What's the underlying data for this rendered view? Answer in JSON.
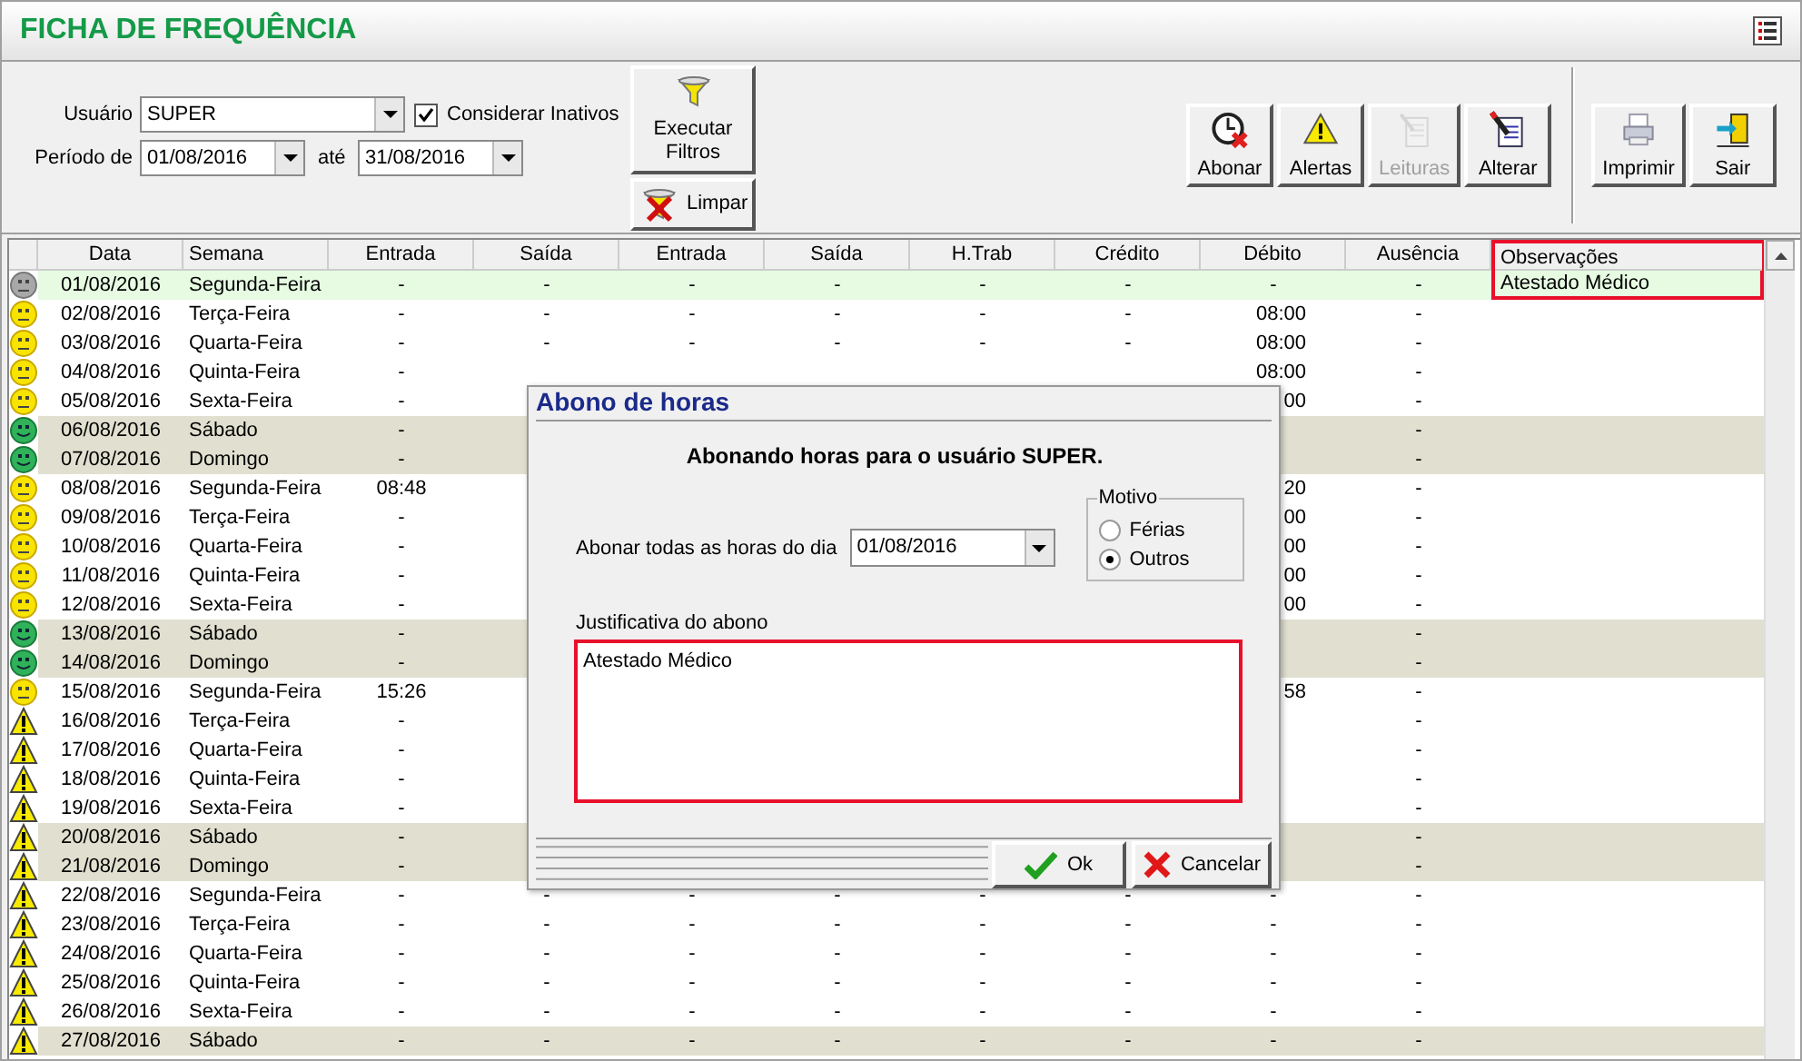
{
  "title": "FICHA DE FREQUÊNCIA",
  "filters": {
    "user_label": "Usuário",
    "user": "SUPER",
    "inactive": {
      "label": "Considerar Inativos",
      "checked": true
    },
    "period_label": "Período de",
    "date_from": "01/08/2016",
    "until_label": "até",
    "date_to": "31/08/2016"
  },
  "filter_buttons": [
    {
      "label": "Executar Filtros",
      "kind": "run"
    },
    {
      "label": "Limpar",
      "kind": "clear"
    }
  ],
  "toolbar": [
    {
      "label": "Abonar",
      "disabled": false
    },
    {
      "label": "Alertas",
      "disabled": false
    },
    {
      "label": "Leituras",
      "disabled": true
    },
    {
      "label": "Alterar",
      "disabled": false
    },
    {
      "label": "Imprimir",
      "disabled": false
    },
    {
      "label": "Sair",
      "disabled": false
    }
  ],
  "table": {
    "columns": [
      "Data",
      "Semana",
      "Entrada",
      "Saída",
      "Entrada",
      "Saída",
      "H.Trab",
      "Crédito",
      "Débito",
      "Ausência",
      "Observações"
    ],
    "notes_highlighted": true,
    "rows": [
      {
        "kind": "neutral",
        "cells": [
          "01/08/2016",
          "Segunda-Feira",
          "-",
          "-",
          "-",
          "-",
          "-",
          "-",
          "-",
          "-",
          "Atestado Médico"
        ],
        "selected": true,
        "weekend": false
      },
      {
        "kind": "ok",
        "cells": [
          "02/08/2016",
          "Terça-Feira",
          "-",
          "-",
          "-",
          "-",
          "-",
          "-",
          "08:00",
          "-",
          null
        ],
        "selected": false,
        "weekend": false
      },
      {
        "kind": "ok",
        "cells": [
          "03/08/2016",
          "Quarta-Feira",
          "-",
          "-",
          "-",
          "-",
          "-",
          "-",
          "08:00",
          "-",
          null
        ],
        "selected": false,
        "weekend": false
      },
      {
        "kind": "ok",
        "cells": [
          "04/08/2016",
          "Quinta-Feira",
          "-",
          null,
          null,
          null,
          null,
          null,
          "08:00",
          "-",
          null
        ],
        "selected": false,
        "weekend": false
      },
      {
        "kind": "ok",
        "cells": [
          "05/08/2016",
          "Sexta-Feira",
          "-",
          null,
          null,
          null,
          null,
          null,
          "00",
          "-",
          null
        ],
        "selected": false,
        "weekend": false
      },
      {
        "kind": "weekend",
        "cells": [
          "06/08/2016",
          "Sábado",
          "-",
          null,
          null,
          null,
          null,
          null,
          null,
          "-",
          null
        ],
        "selected": false,
        "weekend": true
      },
      {
        "kind": "weekend",
        "cells": [
          "07/08/2016",
          "Domingo",
          "-",
          null,
          null,
          null,
          null,
          null,
          null,
          "-",
          null
        ],
        "selected": false,
        "weekend": true
      },
      {
        "kind": "ok",
        "cells": [
          "08/08/2016",
          "Segunda-Feira",
          "08:48",
          null,
          null,
          null,
          null,
          null,
          "20",
          "-",
          null
        ],
        "selected": false,
        "weekend": false
      },
      {
        "kind": "ok",
        "cells": [
          "09/08/2016",
          "Terça-Feira",
          "-",
          null,
          null,
          null,
          null,
          null,
          "00",
          "-",
          null
        ],
        "selected": false,
        "weekend": false
      },
      {
        "kind": "ok",
        "cells": [
          "10/08/2016",
          "Quarta-Feira",
          "-",
          null,
          null,
          null,
          null,
          null,
          "00",
          "-",
          null
        ],
        "selected": false,
        "weekend": false
      },
      {
        "kind": "ok",
        "cells": [
          "11/08/2016",
          "Quinta-Feira",
          "-",
          null,
          null,
          null,
          null,
          null,
          "00",
          "-",
          null
        ],
        "selected": false,
        "weekend": false
      },
      {
        "kind": "ok",
        "cells": [
          "12/08/2016",
          "Sexta-Feira",
          "-",
          null,
          null,
          null,
          null,
          null,
          "00",
          "-",
          null
        ],
        "selected": false,
        "weekend": false
      },
      {
        "kind": "weekend",
        "cells": [
          "13/08/2016",
          "Sábado",
          "-",
          null,
          null,
          null,
          null,
          null,
          null,
          "-",
          null
        ],
        "selected": false,
        "weekend": true
      },
      {
        "kind": "weekend",
        "cells": [
          "14/08/2016",
          "Domingo",
          "-",
          null,
          null,
          null,
          null,
          null,
          null,
          "-",
          null
        ],
        "selected": false,
        "weekend": true
      },
      {
        "kind": "ok",
        "cells": [
          "15/08/2016",
          "Segunda-Feira",
          "15:26",
          null,
          null,
          null,
          null,
          null,
          "58",
          "-",
          null
        ],
        "selected": false,
        "weekend": false
      },
      {
        "kind": "alert",
        "cells": [
          "16/08/2016",
          "Terça-Feira",
          "-",
          null,
          null,
          null,
          null,
          null,
          null,
          "-",
          null
        ],
        "selected": false,
        "weekend": false
      },
      {
        "kind": "alert",
        "cells": [
          "17/08/2016",
          "Quarta-Feira",
          "-",
          null,
          null,
          null,
          null,
          null,
          null,
          "-",
          null
        ],
        "selected": false,
        "weekend": false
      },
      {
        "kind": "alert",
        "cells": [
          "18/08/2016",
          "Quinta-Feira",
          "-",
          null,
          null,
          null,
          null,
          null,
          null,
          "-",
          null
        ],
        "selected": false,
        "weekend": false
      },
      {
        "kind": "alert",
        "cells": [
          "19/08/2016",
          "Sexta-Feira",
          "-",
          null,
          null,
          null,
          null,
          null,
          null,
          "-",
          null
        ],
        "selected": false,
        "weekend": false
      },
      {
        "kind": "alert",
        "cells": [
          "20/08/2016",
          "Sábado",
          "-",
          null,
          null,
          null,
          null,
          null,
          null,
          "-",
          null
        ],
        "selected": false,
        "weekend": true
      },
      {
        "kind": "alert",
        "cells": [
          "21/08/2016",
          "Domingo",
          "-",
          null,
          null,
          null,
          null,
          null,
          null,
          "-",
          null
        ],
        "selected": false,
        "weekend": true
      },
      {
        "kind": "alert",
        "cells": [
          "22/08/2016",
          "Segunda-Feira",
          "-",
          "-",
          "-",
          "-",
          "-",
          "-",
          "-",
          "-",
          null
        ],
        "selected": false,
        "weekend": false
      },
      {
        "kind": "alert",
        "cells": [
          "23/08/2016",
          "Terça-Feira",
          "-",
          "-",
          "-",
          "-",
          "-",
          "-",
          "-",
          "-",
          null
        ],
        "selected": false,
        "weekend": false
      },
      {
        "kind": "alert",
        "cells": [
          "24/08/2016",
          "Quarta-Feira",
          "-",
          "-",
          "-",
          "-",
          "-",
          "-",
          "-",
          "-",
          null
        ],
        "selected": false,
        "weekend": false
      },
      {
        "kind": "alert",
        "cells": [
          "25/08/2016",
          "Quinta-Feira",
          "-",
          "-",
          "-",
          "-",
          "-",
          "-",
          "-",
          "-",
          null
        ],
        "selected": false,
        "weekend": false
      },
      {
        "kind": "alert",
        "cells": [
          "26/08/2016",
          "Sexta-Feira",
          "-",
          "-",
          "-",
          "-",
          "-",
          "-",
          "-",
          "-",
          null
        ],
        "selected": false,
        "weekend": false
      },
      {
        "kind": "alert",
        "cells": [
          "27/08/2016",
          "Sábado",
          "-",
          "-",
          "-",
          "-",
          "-",
          "-",
          "-",
          "-",
          null
        ],
        "selected": false,
        "weekend": true
      }
    ]
  },
  "dialog": {
    "title": "Abono de horas",
    "message": "Abonando horas para o usuário SUPER.",
    "date_label": "Abonar todas as horas do dia",
    "date": "01/08/2016",
    "reason_group": "Motivo",
    "reasons": [
      {
        "label": "Férias",
        "selected": false
      },
      {
        "label": "Outros",
        "selected": true
      }
    ],
    "justification_label": "Justificativa do abono",
    "justification": "Atestado Médico",
    "justification_highlighted": true,
    "buttons": [
      {
        "label": "Ok",
        "kind": "ok"
      },
      {
        "label": "Cancelar",
        "kind": "cancel"
      }
    ]
  }
}
